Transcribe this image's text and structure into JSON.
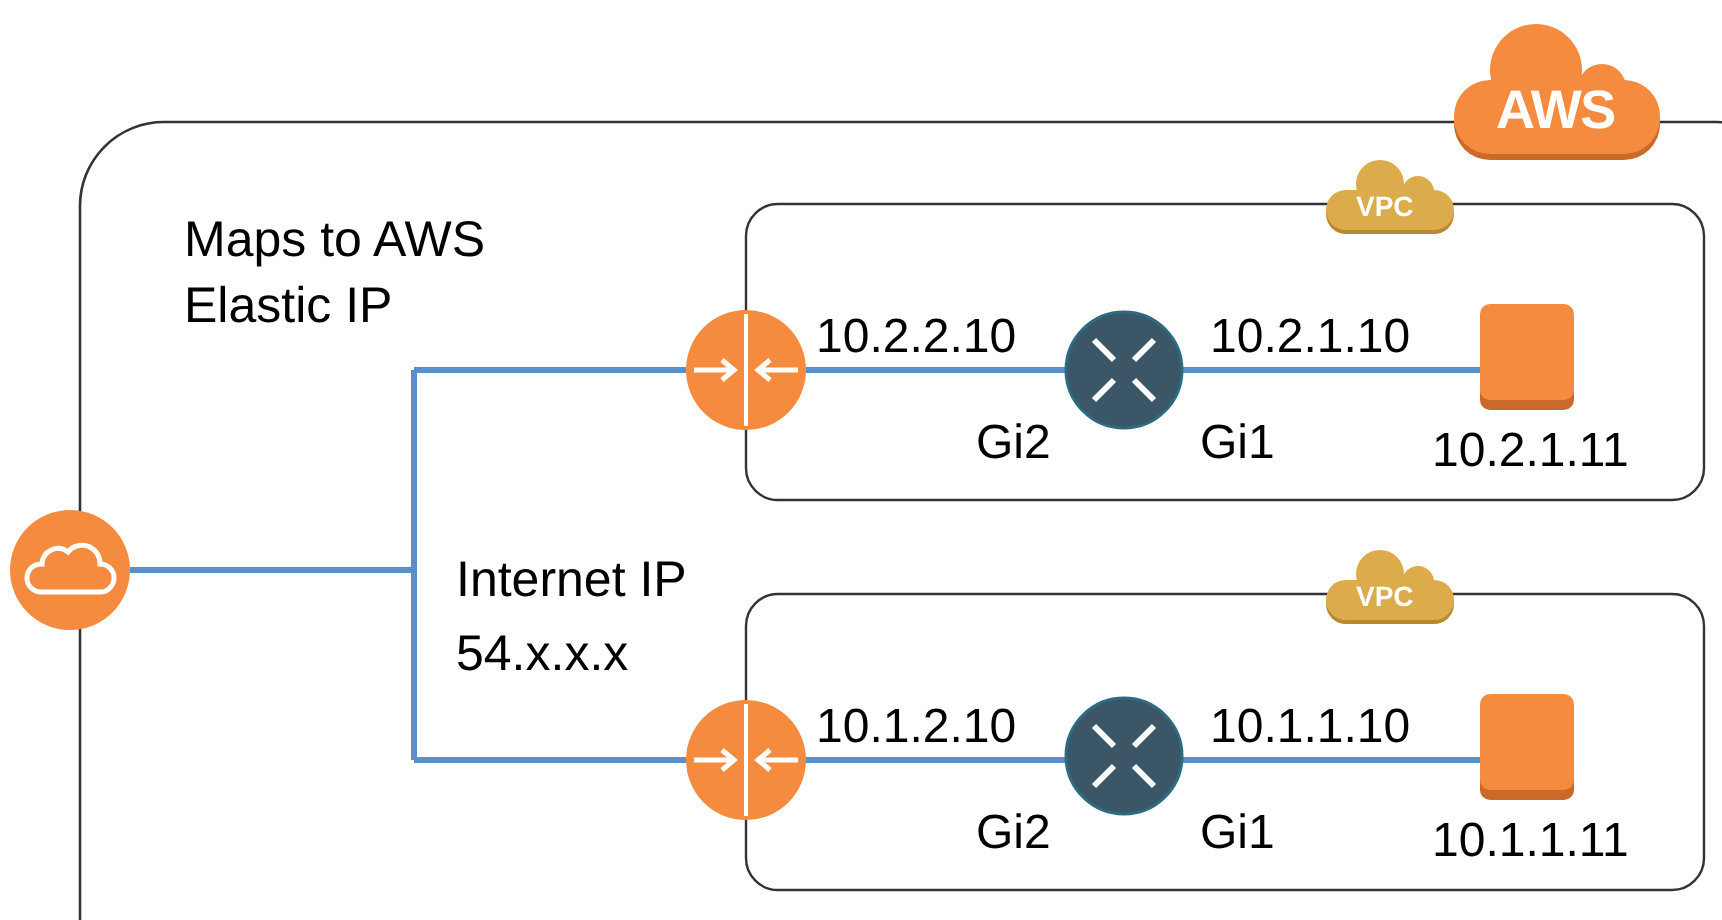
{
  "cloud_badge": "AWS",
  "elastic_ip_note": [
    "Maps to AWS",
    "Elastic IP"
  ],
  "internet_ip_note": [
    "Internet IP",
    "54.x.x.x"
  ],
  "vpcs": [
    {
      "badge": "VPC",
      "gateway_side_ip": "10.2.2.10",
      "gateway_side_port": "Gi2",
      "instance_side_ip": "10.2.1.10",
      "instance_side_port": "Gi1",
      "instance_ip": "10.2.1.11"
    },
    {
      "badge": "VPC",
      "gateway_side_ip": "10.1.2.10",
      "gateway_side_port": "Gi2",
      "instance_side_ip": "10.1.1.10",
      "instance_side_port": "Gi1",
      "instance_ip": "10.1.1.11"
    }
  ]
}
